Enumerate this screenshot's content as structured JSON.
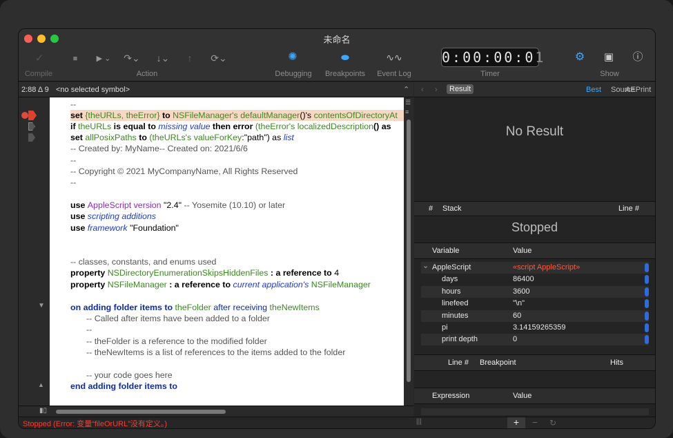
{
  "window": {
    "title": "未命名"
  },
  "toolbar": {
    "compile": "Compile",
    "action": "Action",
    "debugging": "Debugging",
    "breakpoints": "Breakpoints",
    "event_log": "Event Log",
    "timer": "Timer",
    "show": "Show",
    "timer_value": "0:00:00:0"
  },
  "editor": {
    "position": "2:88 Δ 9",
    "symbol": "<no selected symbol>"
  },
  "code": {
    "l1": "--",
    "l2a": "set ",
    "l2b": "{theURLs, theError}",
    "l2c": " to ",
    "l2d": "NSFileManager's",
    "l2e": " defaultManager",
    "l2f": "()'s ",
    "l2g": "contentsOfDirectoryAt",
    "l3a": "if ",
    "l3b": "theURLs",
    "l3c": " is equal to ",
    "l3d": "missing value",
    "l3e": " then error ",
    "l3f": "(theError's ",
    "l3g": "localizedDescription",
    "l3h": "() as ",
    "l4a": "set ",
    "l4b": "allPosixPaths",
    "l4c": " to ",
    "l4d": "(theURLs's ",
    "l4e": "valueForKey",
    "l4f": ":\"path\") as ",
    "l4g": "list",
    "l5": "--   Created by: MyName-- Created on: 2021/6/6",
    "l6": "--",
    "l7": "--   Copyright © 2021 MyCompanyName, All Rights Reserved",
    "l8": "--",
    "l9a": "use ",
    "l9b": "AppleScript",
    "l9c": " version ",
    "l9d": "\"2.4\"",
    "l9e": " -- Yosemite (10.10) or later",
    "l10a": "use ",
    "l10b": "scripting additions",
    "l11a": "use ",
    "l11b": "framework",
    "l11c": " \"Foundation\"",
    "l12": "-- classes, constants, and enums used",
    "l13a": "property ",
    "l13b": "NSDirectoryEnumerationSkipsHiddenFiles",
    "l13c": " : a reference to ",
    "l13d": "4",
    "l14a": "property ",
    "l14b": "NSFileManager",
    "l14c": " : a reference to ",
    "l14d": "current application's",
    "l14e": " NSFileManager",
    "l15a": "on ",
    "l15b": "adding folder items to",
    "l15c": " theFolder",
    "l15d": " after receiving",
    "l15e": " theNewItems",
    "l16": "--   Called after items have been added to a folder",
    "l17": "--",
    "l18": "--   theFolder is a reference to the modified folder",
    "l19": "--   theNewItems is a list of references to the items added to the folder",
    "l20": "-- your code goes here",
    "l21a": "end ",
    "l21b": "adding folder items to"
  },
  "right": {
    "result_tab": "Result",
    "best": "Best",
    "source": "Source",
    "aeprint": "AEPrint",
    "no_result": "No Result",
    "hash": "#",
    "stack": "Stack",
    "line_no": "Line #",
    "stopped": "Stopped",
    "variable": "Variable",
    "value": "Value",
    "variables": [
      {
        "name": "AppleScript",
        "value": "«script AppleScript»"
      },
      {
        "name": "days",
        "value": "86400"
      },
      {
        "name": "hours",
        "value": "3600"
      },
      {
        "name": "linefeed",
        "value": "\"\\n\""
      },
      {
        "name": "minutes",
        "value": "60"
      },
      {
        "name": "pi",
        "value": "3.14159265359"
      },
      {
        "name": "print depth",
        "value": "0"
      }
    ],
    "bp_line": "Line #",
    "breakpoint": "Breakpoint",
    "hits": "Hits",
    "expression": "Expression",
    "expr_value": "Value"
  },
  "status": {
    "text": "Stopped (Error: 变量“fileOrURL”没有定义。)"
  }
}
